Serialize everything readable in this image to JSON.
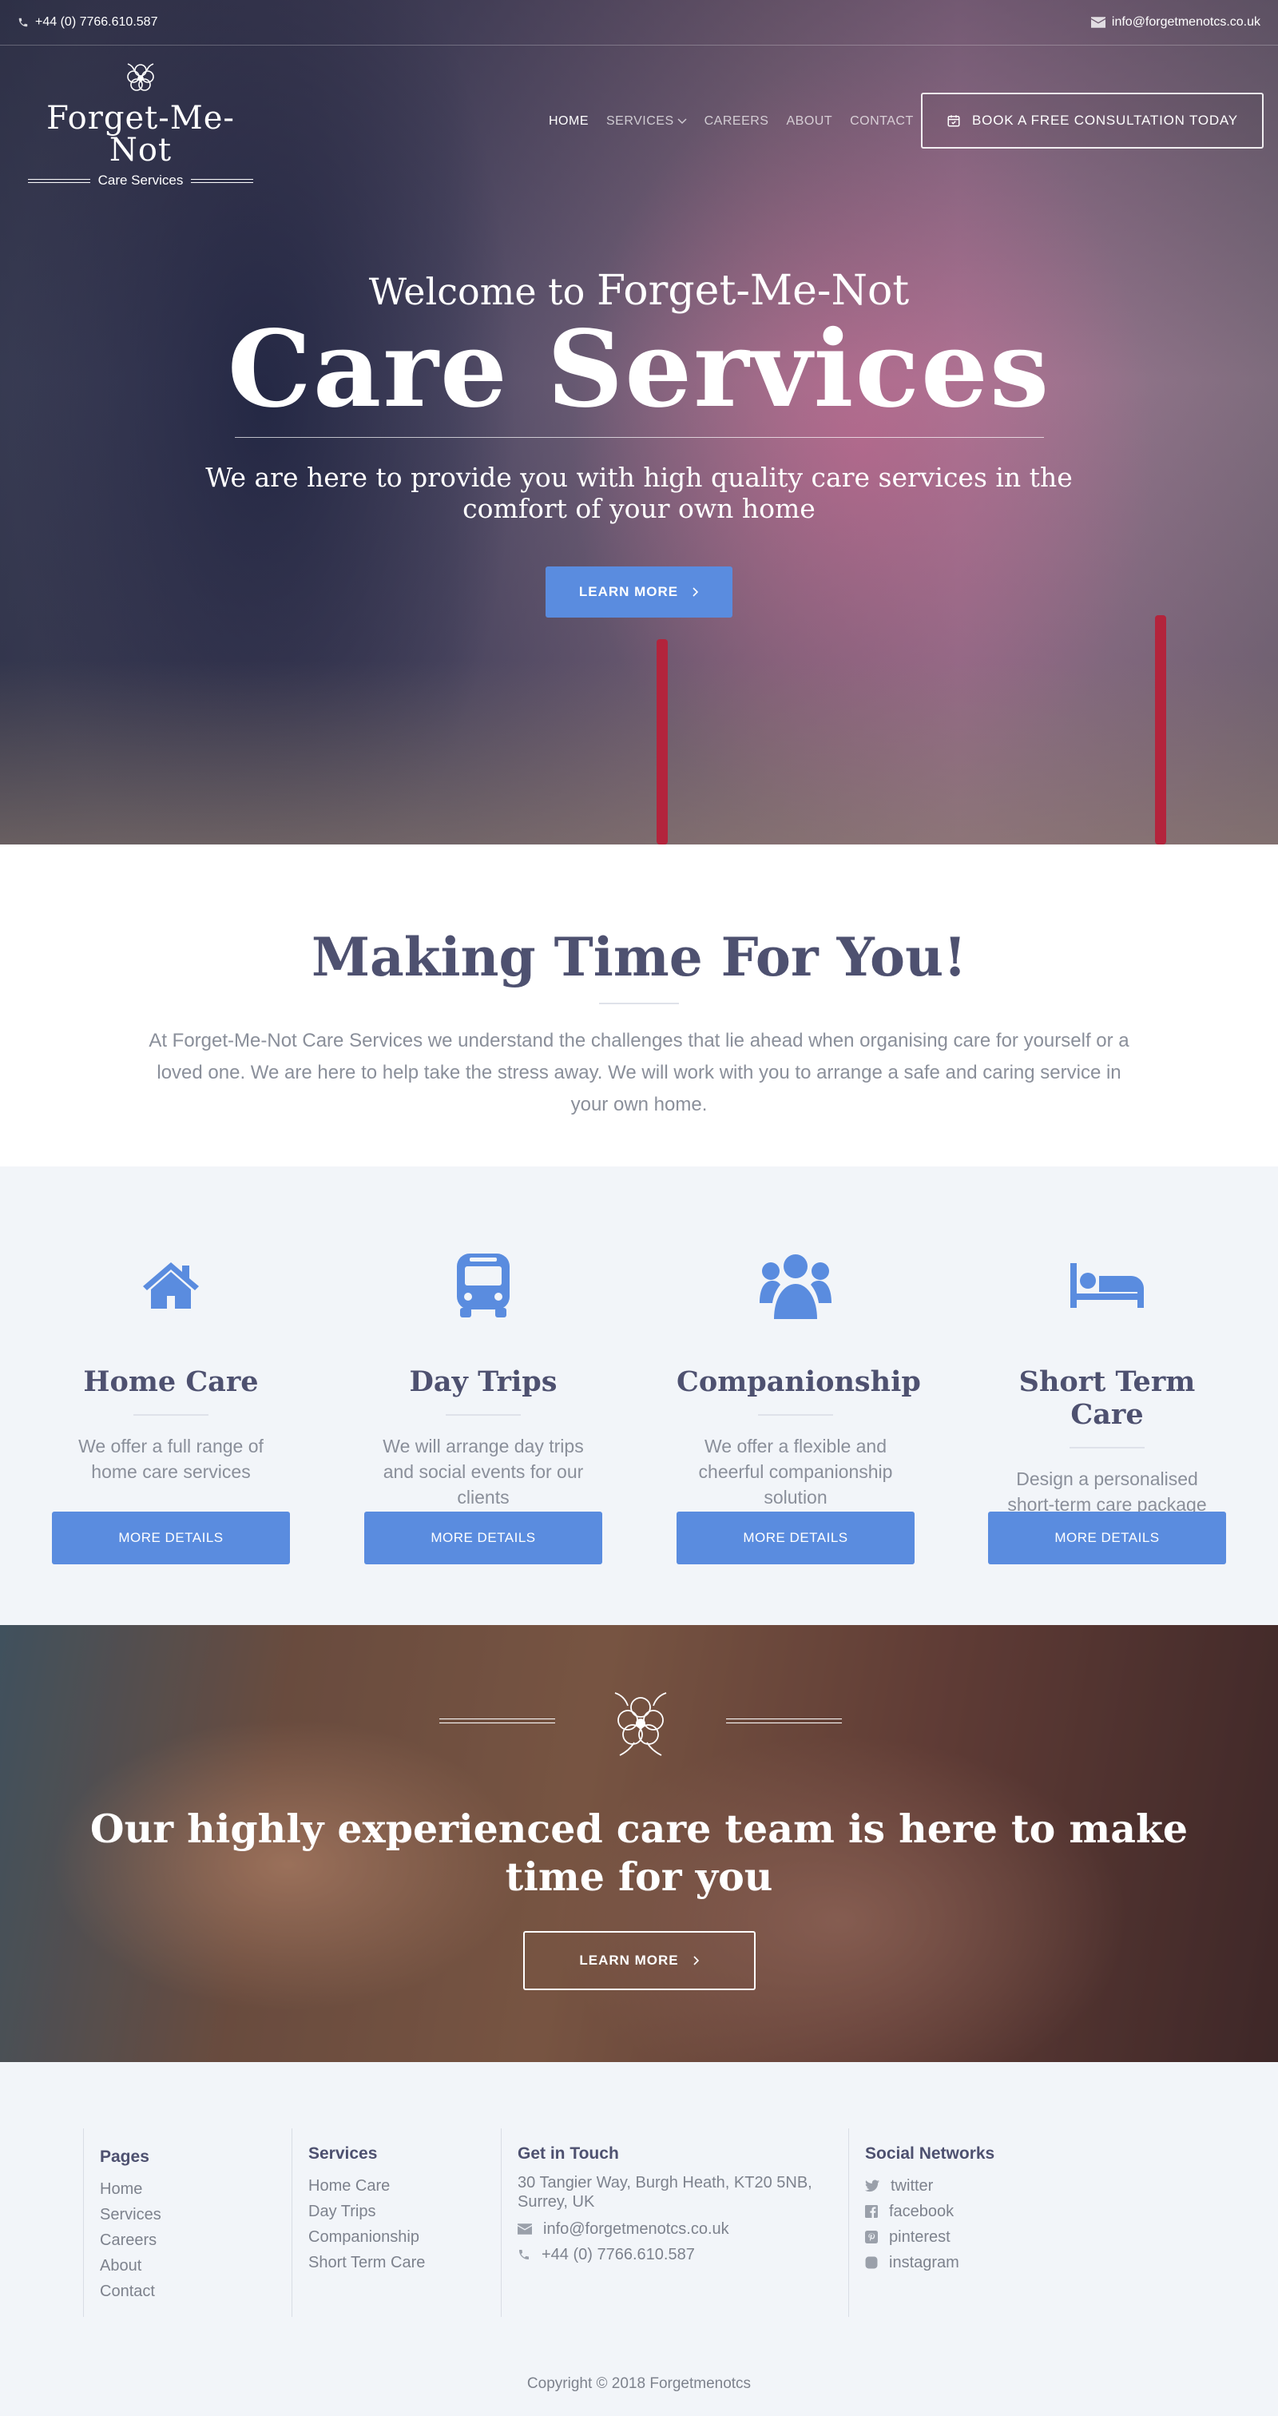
{
  "topbar": {
    "phone": "+44 (0) 7766.610.587",
    "email": "info@forgetmenotcs.co.uk"
  },
  "logo": {
    "name": "Forget-Me-Not",
    "subtitle": "Care Services"
  },
  "nav": {
    "items": [
      "HOME",
      "SERVICES",
      "CAREERS",
      "ABOUT",
      "CONTACT"
    ],
    "active": "HOME",
    "book_label": "BOOK A FREE CONSULTATION TODAY"
  },
  "hero": {
    "welcome_prefix": "Welcome to",
    "welcome_brand": "Forget-Me-Not",
    "title": "Care Services",
    "tagline_line1": "We are here to provide you with high quality care services in the",
    "tagline_line2": "comfort of your own home",
    "button": "LEARN MORE"
  },
  "intro": {
    "heading": "Making Time For You!",
    "text": "At Forget-Me-Not Care Services we understand the challenges that lie ahead when organising care for yourself or a loved one. We are here to help take the stress away. We will work with you to arrange a safe and caring service in your own home."
  },
  "services": [
    {
      "icon": "home-icon",
      "title": "Home Care",
      "text": "We offer a full range of home care services",
      "button": "MORE DETAILS"
    },
    {
      "icon": "bus-icon",
      "title": "Day Trips",
      "text": "We will arrange day trips and social events for our clients",
      "button": "MORE DETAILS"
    },
    {
      "icon": "users-icon",
      "title": "Companionship",
      "text": "We offer a flexible and cheerful companionship solution",
      "button": "MORE DETAILS"
    },
    {
      "icon": "bed-icon",
      "title": "Short Term Care",
      "text": "Design a personalised short-term care package",
      "button": "MORE DETAILS"
    }
  ],
  "team": {
    "heading": "Our highly experienced care team is here to make time for you",
    "button": "LEARN MORE"
  },
  "footer": {
    "pages": {
      "title": "Pages",
      "links": [
        "Home",
        "Services",
        "Careers",
        "About",
        "Contact"
      ]
    },
    "services": {
      "title": "Services",
      "links": [
        "Home Care",
        "Day Trips",
        "Companionship",
        "Short Term Care"
      ]
    },
    "contact": {
      "title": "Get in Touch",
      "address": "30 Tangier Way, Burgh Heath, KT20 5NB, Surrey, UK",
      "email": "info@forgetmenotcs.co.uk",
      "phone": "+44 (0) 7766.610.587"
    },
    "social": {
      "title": "Social Networks",
      "links": [
        "twitter",
        "facebook",
        "pinterest",
        "instagram"
      ]
    },
    "copyright": "Copyright © 2018 Forgetmenotcs"
  },
  "colors": {
    "accent": "#5a8cdf",
    "heading": "#4e5170",
    "muted_text": "#8a8f9a",
    "section_bg": "#f2f5f9"
  }
}
